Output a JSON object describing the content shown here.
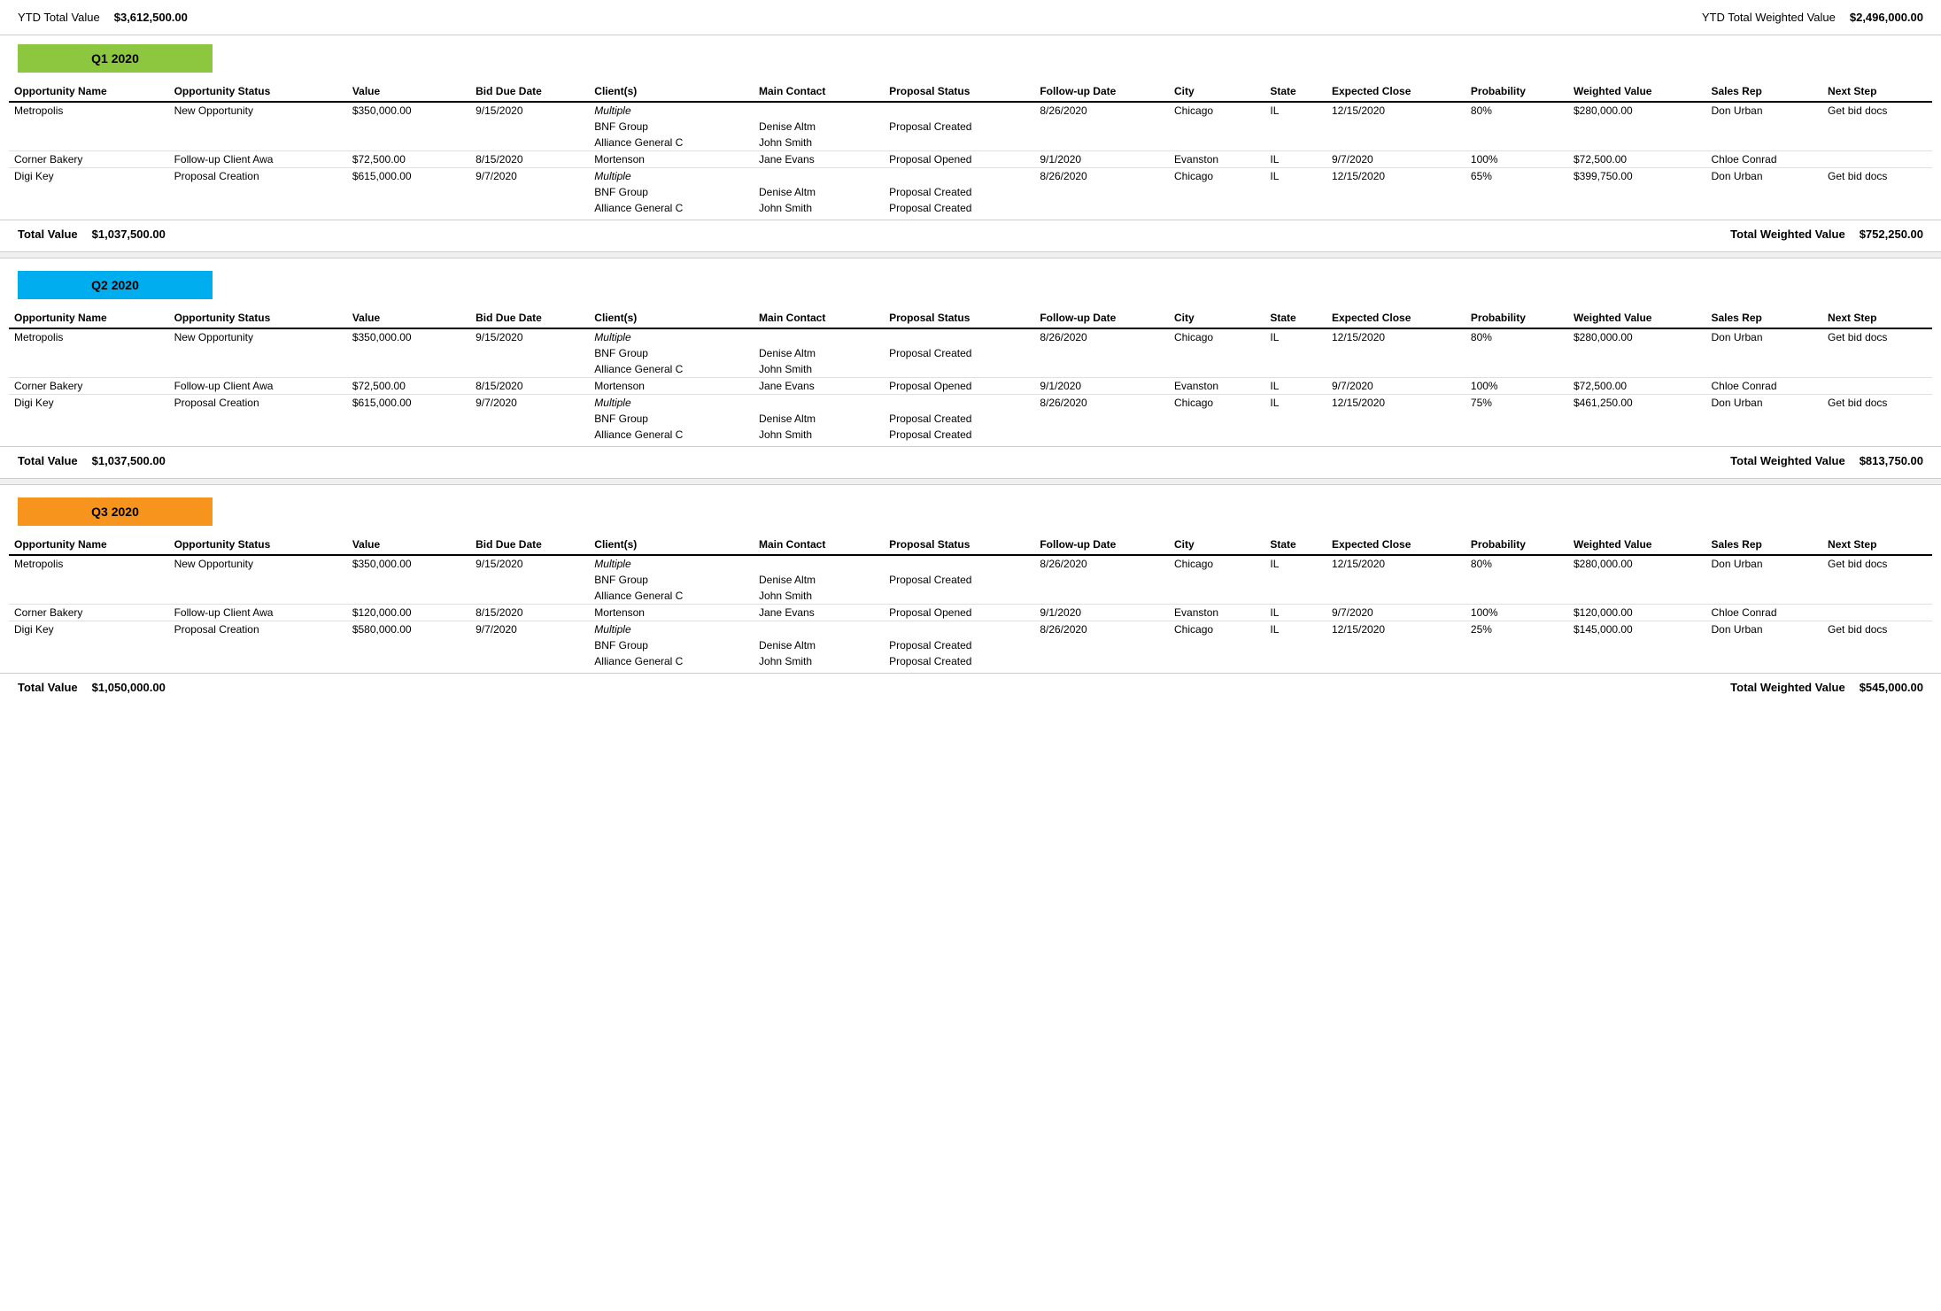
{
  "topBar": {
    "ytdLabel": "YTD Total Value",
    "ytdValue": "$3,612,500.00",
    "ytdWeightedLabel": "YTD Total Weighted Value",
    "ytdWeightedValue": "$2,496,000.00"
  },
  "columns": [
    "Opportunity Name",
    "Opportunity Status",
    "Value",
    "Bid Due Date",
    "Client(s)",
    "Main Contact",
    "Proposal Status",
    "Follow-up Date",
    "City",
    "State",
    "Expected Close",
    "Probability",
    "Weighted Value",
    "Sales Rep",
    "Next Step"
  ],
  "quarters": [
    {
      "id": "q1",
      "label": "Q1 2020",
      "colorClass": "q1",
      "totalValue": "$1,037,500.00",
      "totalWeightedValue": "$752,250.00",
      "rows": [
        {
          "name": "Metropolis",
          "status": "New Opportunity",
          "value": "$350,000.00",
          "bidDue": "9/15/2020",
          "client": "Multiple",
          "clientItalic": true,
          "mainContact": "",
          "proposalStatus": "",
          "followUp": "8/26/2020",
          "city": "Chicago",
          "state": "IL",
          "expectedClose": "12/15/2020",
          "probability": "80%",
          "weightedValue": "$280,000.00",
          "salesRep": "Don Urban",
          "nextStep": "Get bid docs",
          "subRows": [
            {
              "client": "BNF Group",
              "mainContact": "Denise Altm",
              "proposalStatus": "Proposal Created"
            },
            {
              "client": "Alliance General C",
              "mainContact": "John Smith",
              "proposalStatus": ""
            }
          ]
        },
        {
          "name": "Corner Bakery",
          "status": "Follow-up Client Awa",
          "value": "$72,500.00",
          "bidDue": "8/15/2020",
          "client": "Mortenson",
          "clientItalic": false,
          "mainContact": "Jane Evans",
          "proposalStatus": "Proposal Opened",
          "followUp": "9/1/2020",
          "city": "Evanston",
          "state": "IL",
          "expectedClose": "9/7/2020",
          "probability": "100%",
          "weightedValue": "$72,500.00",
          "salesRep": "Chloe Conrad",
          "nextStep": "",
          "subRows": []
        },
        {
          "name": "Digi Key",
          "status": "Proposal Creation",
          "value": "$615,000.00",
          "bidDue": "9/7/2020",
          "client": "Multiple",
          "clientItalic": true,
          "mainContact": "",
          "proposalStatus": "",
          "followUp": "8/26/2020",
          "city": "Chicago",
          "state": "IL",
          "expectedClose": "12/15/2020",
          "probability": "65%",
          "weightedValue": "$399,750.00",
          "salesRep": "Don Urban",
          "nextStep": "Get bid docs",
          "subRows": [
            {
              "client": "BNF Group",
              "mainContact": "Denise Altm",
              "proposalStatus": "Proposal Created"
            },
            {
              "client": "Alliance General C",
              "mainContact": "John Smith",
              "proposalStatus": "Proposal Created"
            }
          ]
        }
      ]
    },
    {
      "id": "q2",
      "label": "Q2 2020",
      "colorClass": "q2",
      "totalValue": "$1,037,500.00",
      "totalWeightedValue": "$813,750.00",
      "rows": [
        {
          "name": "Metropolis",
          "status": "New Opportunity",
          "value": "$350,000.00",
          "bidDue": "9/15/2020",
          "client": "Multiple",
          "clientItalic": true,
          "mainContact": "",
          "proposalStatus": "",
          "followUp": "8/26/2020",
          "city": "Chicago",
          "state": "IL",
          "expectedClose": "12/15/2020",
          "probability": "80%",
          "weightedValue": "$280,000.00",
          "salesRep": "Don Urban",
          "nextStep": "Get bid docs",
          "subRows": [
            {
              "client": "BNF Group",
              "mainContact": "Denise Altm",
              "proposalStatus": "Proposal Created"
            },
            {
              "client": "Alliance General C",
              "mainContact": "John Smith",
              "proposalStatus": ""
            }
          ]
        },
        {
          "name": "Corner Bakery",
          "status": "Follow-up Client Awa",
          "value": "$72,500.00",
          "bidDue": "8/15/2020",
          "client": "Mortenson",
          "clientItalic": false,
          "mainContact": "Jane Evans",
          "proposalStatus": "Proposal Opened",
          "followUp": "9/1/2020",
          "city": "Evanston",
          "state": "IL",
          "expectedClose": "9/7/2020",
          "probability": "100%",
          "weightedValue": "$72,500.00",
          "salesRep": "Chloe Conrad",
          "nextStep": "",
          "subRows": []
        },
        {
          "name": "Digi Key",
          "status": "Proposal Creation",
          "value": "$615,000.00",
          "bidDue": "9/7/2020",
          "client": "Multiple",
          "clientItalic": true,
          "mainContact": "",
          "proposalStatus": "",
          "followUp": "8/26/2020",
          "city": "Chicago",
          "state": "IL",
          "expectedClose": "12/15/2020",
          "probability": "75%",
          "weightedValue": "$461,250.00",
          "salesRep": "Don Urban",
          "nextStep": "Get bid docs",
          "subRows": [
            {
              "client": "BNF Group",
              "mainContact": "Denise Altm",
              "proposalStatus": "Proposal Created"
            },
            {
              "client": "Alliance General C",
              "mainContact": "John Smith",
              "proposalStatus": "Proposal Created"
            }
          ]
        }
      ]
    },
    {
      "id": "q3",
      "label": "Q3 2020",
      "colorClass": "q3",
      "totalValue": "$1,050,000.00",
      "totalWeightedValue": "$545,000.00",
      "rows": [
        {
          "name": "Metropolis",
          "status": "New Opportunity",
          "value": "$350,000.00",
          "bidDue": "9/15/2020",
          "client": "Multiple",
          "clientItalic": true,
          "mainContact": "",
          "proposalStatus": "",
          "followUp": "8/26/2020",
          "city": "Chicago",
          "state": "IL",
          "expectedClose": "12/15/2020",
          "probability": "80%",
          "weightedValue": "$280,000.00",
          "salesRep": "Don Urban",
          "nextStep": "Get bid docs",
          "subRows": [
            {
              "client": "BNF Group",
              "mainContact": "Denise Altm",
              "proposalStatus": "Proposal Created"
            },
            {
              "client": "Alliance General C",
              "mainContact": "John Smith",
              "proposalStatus": ""
            }
          ]
        },
        {
          "name": "Corner Bakery",
          "status": "Follow-up Client Awa",
          "value": "$120,000.00",
          "bidDue": "8/15/2020",
          "client": "Mortenson",
          "clientItalic": false,
          "mainContact": "Jane Evans",
          "proposalStatus": "Proposal Opened",
          "followUp": "9/1/2020",
          "city": "Evanston",
          "state": "IL",
          "expectedClose": "9/7/2020",
          "probability": "100%",
          "weightedValue": "$120,000.00",
          "salesRep": "Chloe Conrad",
          "nextStep": "",
          "subRows": []
        },
        {
          "name": "Digi Key",
          "status": "Proposal Creation",
          "value": "$580,000.00",
          "bidDue": "9/7/2020",
          "client": "Multiple",
          "clientItalic": true,
          "mainContact": "",
          "proposalStatus": "",
          "followUp": "8/26/2020",
          "city": "Chicago",
          "state": "IL",
          "expectedClose": "12/15/2020",
          "probability": "25%",
          "weightedValue": "$145,000.00",
          "salesRep": "Don Urban",
          "nextStep": "Get bid docs",
          "subRows": [
            {
              "client": "BNF Group",
              "mainContact": "Denise Altm",
              "proposalStatus": "Proposal Created"
            },
            {
              "client": "Alliance General C",
              "mainContact": "John Smith",
              "proposalStatus": "Proposal Created"
            }
          ]
        }
      ]
    }
  ]
}
